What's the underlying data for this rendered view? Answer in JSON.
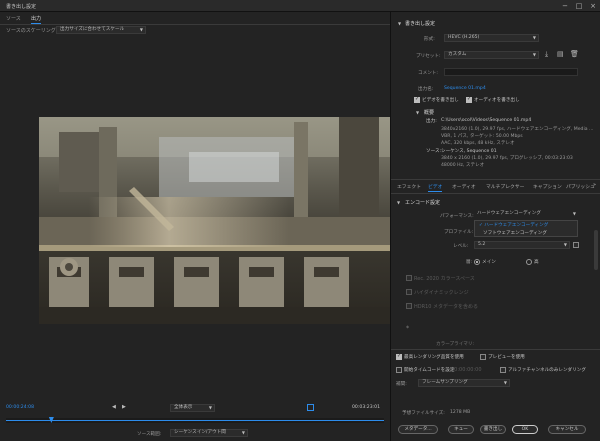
{
  "window": {
    "title": "書き出し設定"
  },
  "left_tabs": [
    "ソース",
    "出力"
  ],
  "source_scaling": {
    "label": "ソースのスケーリング:",
    "value": "出力サイズに合わせてスケール"
  },
  "timeline": {
    "current_time": "00:00:24:08",
    "zoom": "全体表示",
    "end_time": "00:03:23:01",
    "range_label": "ソース範囲:",
    "range_value": "シーケンスイン/アウト間",
    "playhead_fraction": 0.12
  },
  "export_settings": {
    "header": "書き出し設定",
    "format_label": "形式:",
    "format_value": "HEVC (H.265)",
    "preset_label": "プリセット:",
    "preset_value": "カスタム",
    "comment_label": "コメント:",
    "output_name_label": "出力名:",
    "output_name_value": "Sequence 01.mp4",
    "export_video": "ビデオを書き出し",
    "export_audio": "オーディオを書き出し"
  },
  "summary": {
    "header": "概要",
    "output_label": "出力:",
    "output_lines": [
      "C:\\Users\\ocol\\Videos\\Sequence 01.mp4",
      "3840x2160 (1.0), 29.97 fps, ハードウェアエンコーディング, Media ...",
      "VBR, 1 パス, ターゲット: 50.00 Mbps",
      "AAC, 320 kbps, 48 kHz, ステレオ"
    ],
    "source_label": "ソース:",
    "source_lines": [
      "シーケンス, Sequence 01",
      "3840 x 2160 (1.0), 29.97 fps, プログレッシブ, 00:03:23:03",
      "48000 Hz, ステレオ"
    ]
  },
  "right_tabs": [
    "エフェクト",
    "ビデオ",
    "オーディオ",
    "マルチプレクサー",
    "キャプション",
    "パブリッシュ"
  ],
  "encode": {
    "header": "エンコード設定",
    "performance_label": "パフォーマンス:",
    "performance_value": "ハードウェアエンコーディング",
    "performance_options": [
      "✓ ハードウェアエンコーディング",
      "ソフトウェアエンコーディング"
    ],
    "profile_label": "プロファイル:",
    "level_label": "レベル:",
    "level_value": "5.2",
    "tier_label": "層:",
    "tier_main": "メイン",
    "tier_high": "高",
    "disabled_rows": [
      "Rec. 2020 カラースペース",
      "ハイダイナミックレンジ",
      "HDR10 メタデータを含める"
    ],
    "bitrate_label": "カラープライマリ:"
  },
  "bottom_options": {
    "max_render_quality": "最高レンダリング品質を使用",
    "use_previews": "プレビューを使用",
    "set_start_timecode": "開始タイムコードを設定",
    "timecode_value": "00:00:00:00",
    "alpha_only": "アルファチャンネルのみレンダリング",
    "interpolation_label": "補間:",
    "interpolation_value": "フレームサンプリング",
    "file_size_label": "予想ファイルサイズ:",
    "file_size_value": "1278 MB"
  },
  "buttons": {
    "metadata": "メタデータ...",
    "queue": "キュー",
    "export": "書き出し",
    "ok": "OK",
    "cancel": "キャンセル"
  },
  "colors": {
    "accent": "#2d8ceb",
    "panel": "#232323"
  }
}
